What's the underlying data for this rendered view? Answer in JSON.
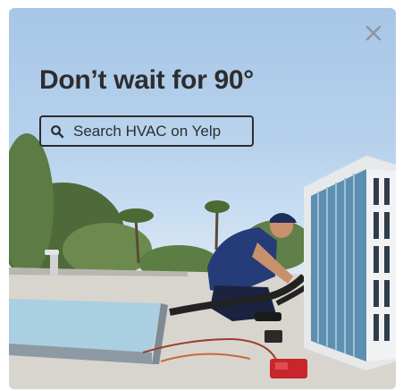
{
  "ad": {
    "headline": "Don’t wait for 90°",
    "search_label": "Search HVAC on Yelp",
    "icons": {
      "close": "close-icon",
      "search": "search-icon"
    }
  },
  "colors": {
    "text": "#2d2d2d",
    "sky": "#b6d1ec",
    "close": "#8f949a"
  }
}
